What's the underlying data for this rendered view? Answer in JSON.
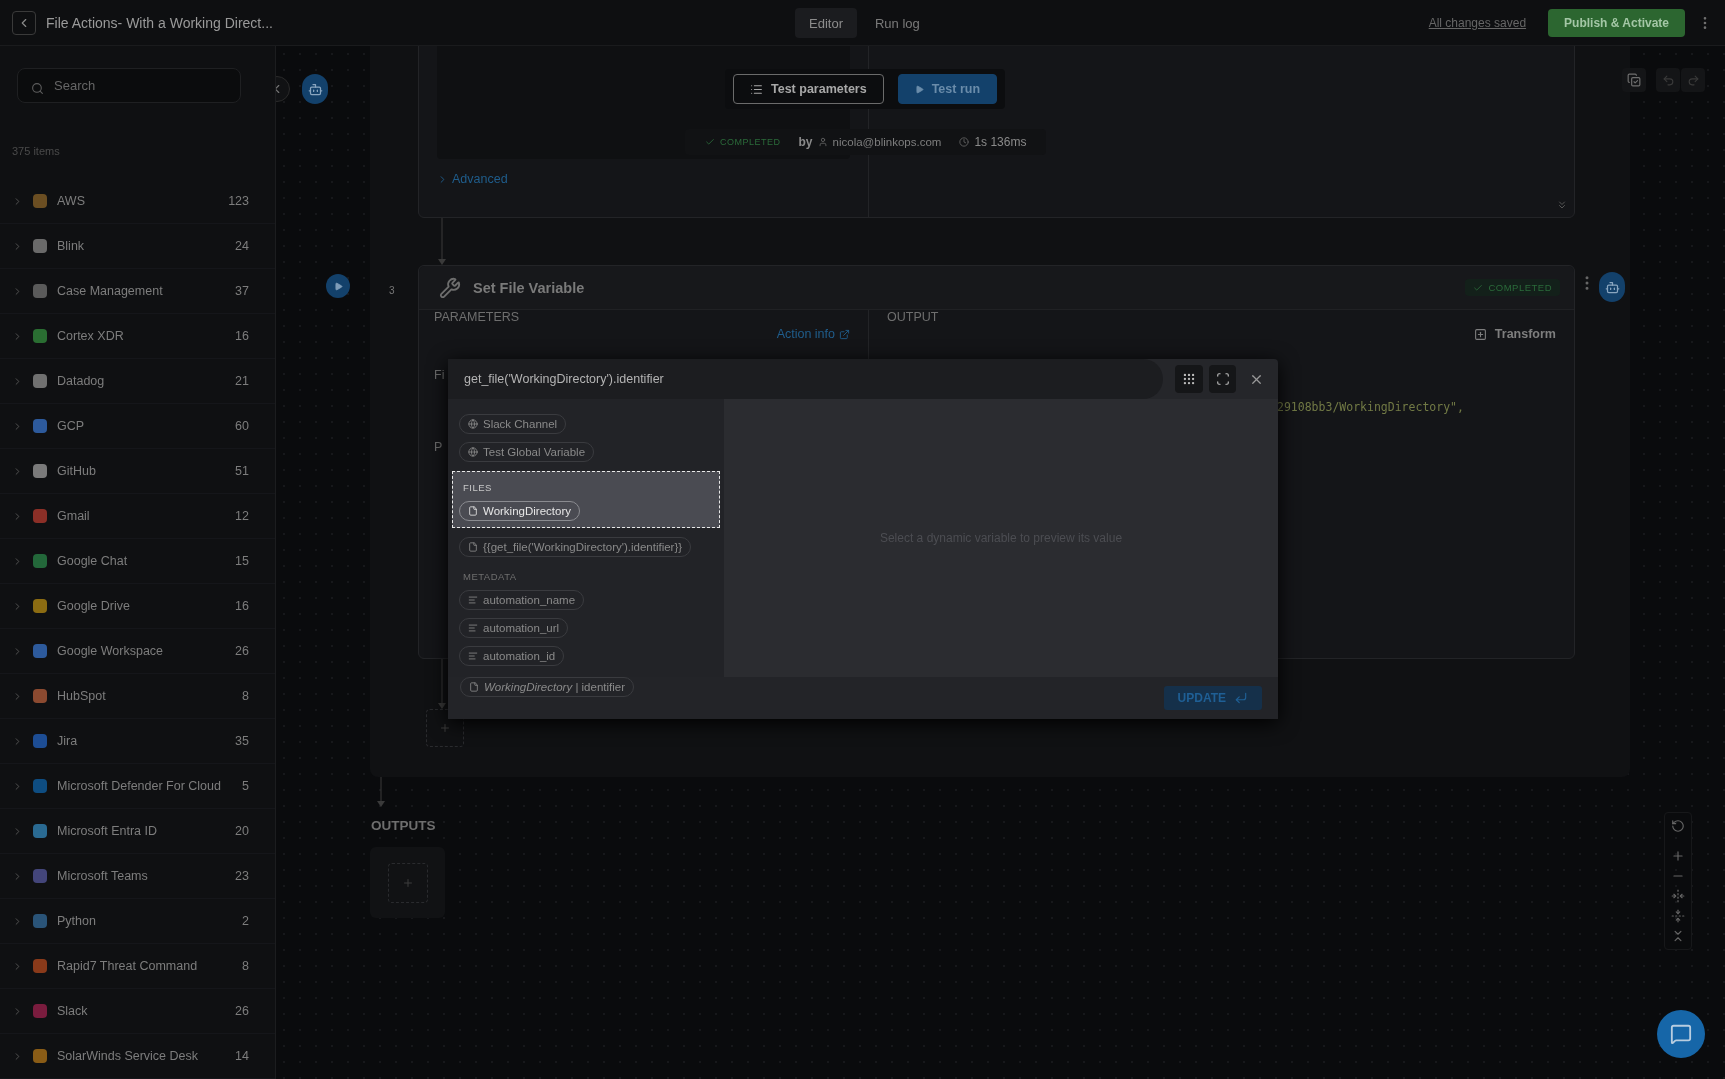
{
  "header": {
    "title": "File Actions- With a Working Direct...",
    "tabs": [
      {
        "label": "Editor",
        "selected": true
      },
      {
        "label": "Run log",
        "selected": false
      }
    ],
    "save_status": "All changes saved",
    "publish_button": "Publish & Activate"
  },
  "sidebar": {
    "search": {
      "placeholder": "Search"
    },
    "count": "375 items",
    "items": [
      {
        "name": "AWS",
        "count": "123",
        "color": "#6b4e22"
      },
      {
        "name": "Blink",
        "count": "24",
        "color": "#6a6a6a"
      },
      {
        "name": "Case Management",
        "count": "37",
        "color": "#5a5a5a"
      },
      {
        "name": "Cortex XDR",
        "count": "16",
        "color": "#2a6e32"
      },
      {
        "name": "Datadog",
        "count": "21",
        "color": "#707070"
      },
      {
        "name": "GCP",
        "count": "60",
        "color": "#2d5a9c"
      },
      {
        "name": "GitHub",
        "count": "51",
        "color": "#7a7a7a"
      },
      {
        "name": "Gmail",
        "count": "12",
        "color": "#8c2f27"
      },
      {
        "name": "Google Chat",
        "count": "15",
        "color": "#23683a"
      },
      {
        "name": "Google Drive",
        "count": "16",
        "color": "#8c6c12"
      },
      {
        "name": "Google Workspace",
        "count": "26",
        "color": "#2d5a9c"
      },
      {
        "name": "HubSpot",
        "count": "8",
        "color": "#8c4a30"
      },
      {
        "name": "Jira",
        "count": "35",
        "color": "#1d4d94"
      },
      {
        "name": "Microsoft Defender For Cloud",
        "count": "5",
        "color": "#0e4d82"
      },
      {
        "name": "Microsoft Entra ID",
        "count": "20",
        "color": "#2a6a92"
      },
      {
        "name": "Microsoft Teams",
        "count": "23",
        "color": "#43457a"
      },
      {
        "name": "Python",
        "count": "2",
        "color": "#2a5478"
      },
      {
        "name": "Rapid7 Threat Command",
        "count": "8",
        "color": "#8a3a1a"
      },
      {
        "name": "Slack",
        "count": "26",
        "color": "#7a1c3e"
      },
      {
        "name": "SolarWinds Service Desk",
        "count": "14",
        "color": "#8a5c16"
      }
    ]
  },
  "canvas": {
    "previous_step": {
      "buttons": [
        {
          "label": "Test parameters",
          "kind": "outline"
        },
        {
          "label": "Test run",
          "kind": "primary"
        }
      ],
      "status": "COMPLETED",
      "by": "by",
      "user": "nicola@blinkops.com",
      "duration": "1s 136ms",
      "advanced": "Advanced"
    },
    "step": {
      "number": "3",
      "title": "Set File Variable",
      "status": "COMPLETED",
      "parameters_label": "PARAMETERS",
      "action_info": "Action info",
      "output_label": "OUTPUT",
      "transform": "Transform",
      "param_labels": [
        "Fi",
        "P"
      ],
      "output_line": "29108bb3/WorkingDirectory\","
    },
    "outputs_label": "OUTPUTS"
  },
  "modal": {
    "expression": "get_file('WorkingDirectory').identifier",
    "sections": [
      {
        "selected": false,
        "items": [
          {
            "kind": "global",
            "label": "Slack Channel"
          },
          {
            "kind": "global",
            "label": "Test Global Variable"
          }
        ]
      },
      {
        "title": "FILES",
        "selected": true,
        "items": [
          {
            "kind": "file",
            "label": "WorkingDirectory"
          }
        ]
      },
      {
        "selected": false,
        "items": [
          {
            "kind": "file",
            "label": "{{get_file('WorkingDirectory').identifier}}"
          }
        ]
      },
      {
        "title": "METADATA",
        "selected": false,
        "items": [
          {
            "kind": "text",
            "label": "automation_name"
          },
          {
            "kind": "text",
            "label": "automation_url"
          },
          {
            "kind": "text",
            "label": "automation_id"
          }
        ]
      }
    ],
    "hint": "Select a dynamic variable to preview its value",
    "chip": "*WorkingDirectory* | identifier",
    "update_button": "UPDATE"
  }
}
